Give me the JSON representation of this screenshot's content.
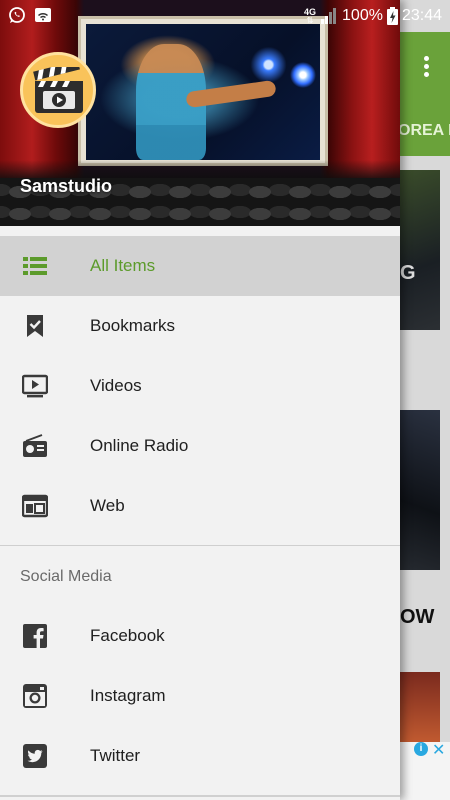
{
  "status_bar": {
    "network_type": "4G",
    "battery_percent": "100%",
    "time": "23:44"
  },
  "background_app": {
    "tab_text": "OREA N",
    "card_label_1": "G",
    "card_label_2": "OW",
    "toolbar_color": "#6aa23a"
  },
  "drawer": {
    "app_name": "Samstudio",
    "accent_color": "#5c9b2b",
    "active_bg": "#d2d2d2",
    "primary_items": [
      {
        "label": "All Items",
        "icon": "list-icon",
        "active": true
      },
      {
        "label": "Bookmarks",
        "icon": "bookmark-icon",
        "active": false
      },
      {
        "label": "Videos",
        "icon": "video-player-icon",
        "active": false
      },
      {
        "label": "Online Radio",
        "icon": "radio-icon",
        "active": false
      },
      {
        "label": "Web",
        "icon": "web-window-icon",
        "active": false
      }
    ],
    "section_title": "Social Media",
    "social_items": [
      {
        "label": "Facebook",
        "icon": "facebook-icon"
      },
      {
        "label": "Instagram",
        "icon": "instagram-icon"
      },
      {
        "label": "Twitter",
        "icon": "twitter-icon"
      }
    ]
  }
}
